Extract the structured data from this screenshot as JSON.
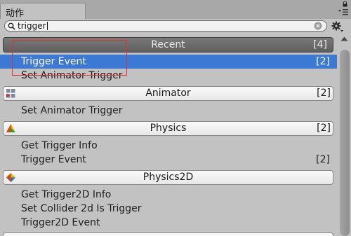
{
  "tab": {
    "title": "动作"
  },
  "search": {
    "value": "trigger"
  },
  "recent": {
    "header": {
      "label": "Recent",
      "count": "[4]"
    },
    "items": [
      {
        "label": "Trigger Event",
        "count": "[2]",
        "selected": true
      },
      {
        "label": "Set Animator Trigger"
      }
    ]
  },
  "animator": {
    "header": {
      "label": "Animator",
      "count": "[2]"
    },
    "items": [
      {
        "label": "Set Animator Trigger"
      }
    ]
  },
  "physics": {
    "header": {
      "label": "Physics",
      "count": "[2]"
    },
    "items": [
      {
        "label": "Get Trigger Info"
      },
      {
        "label": "Trigger Event",
        "count": "[2]"
      }
    ]
  },
  "physics2d": {
    "header": {
      "label": "Physics2D"
    },
    "items": [
      {
        "label": "Get Trigger2D Info"
      },
      {
        "label": "Set Collider 2d Is Trigger"
      },
      {
        "label": "Trigger2D Event"
      }
    ]
  },
  "colors": {
    "selection": "#3c79d4",
    "annotation": "#e03030"
  },
  "icons": [
    "lock-icon",
    "menu-icon",
    "search-icon",
    "clear-icon",
    "gear-icon",
    "animator-icon",
    "physics-icon",
    "physics2d-icon",
    "scroll-up-icon"
  ]
}
